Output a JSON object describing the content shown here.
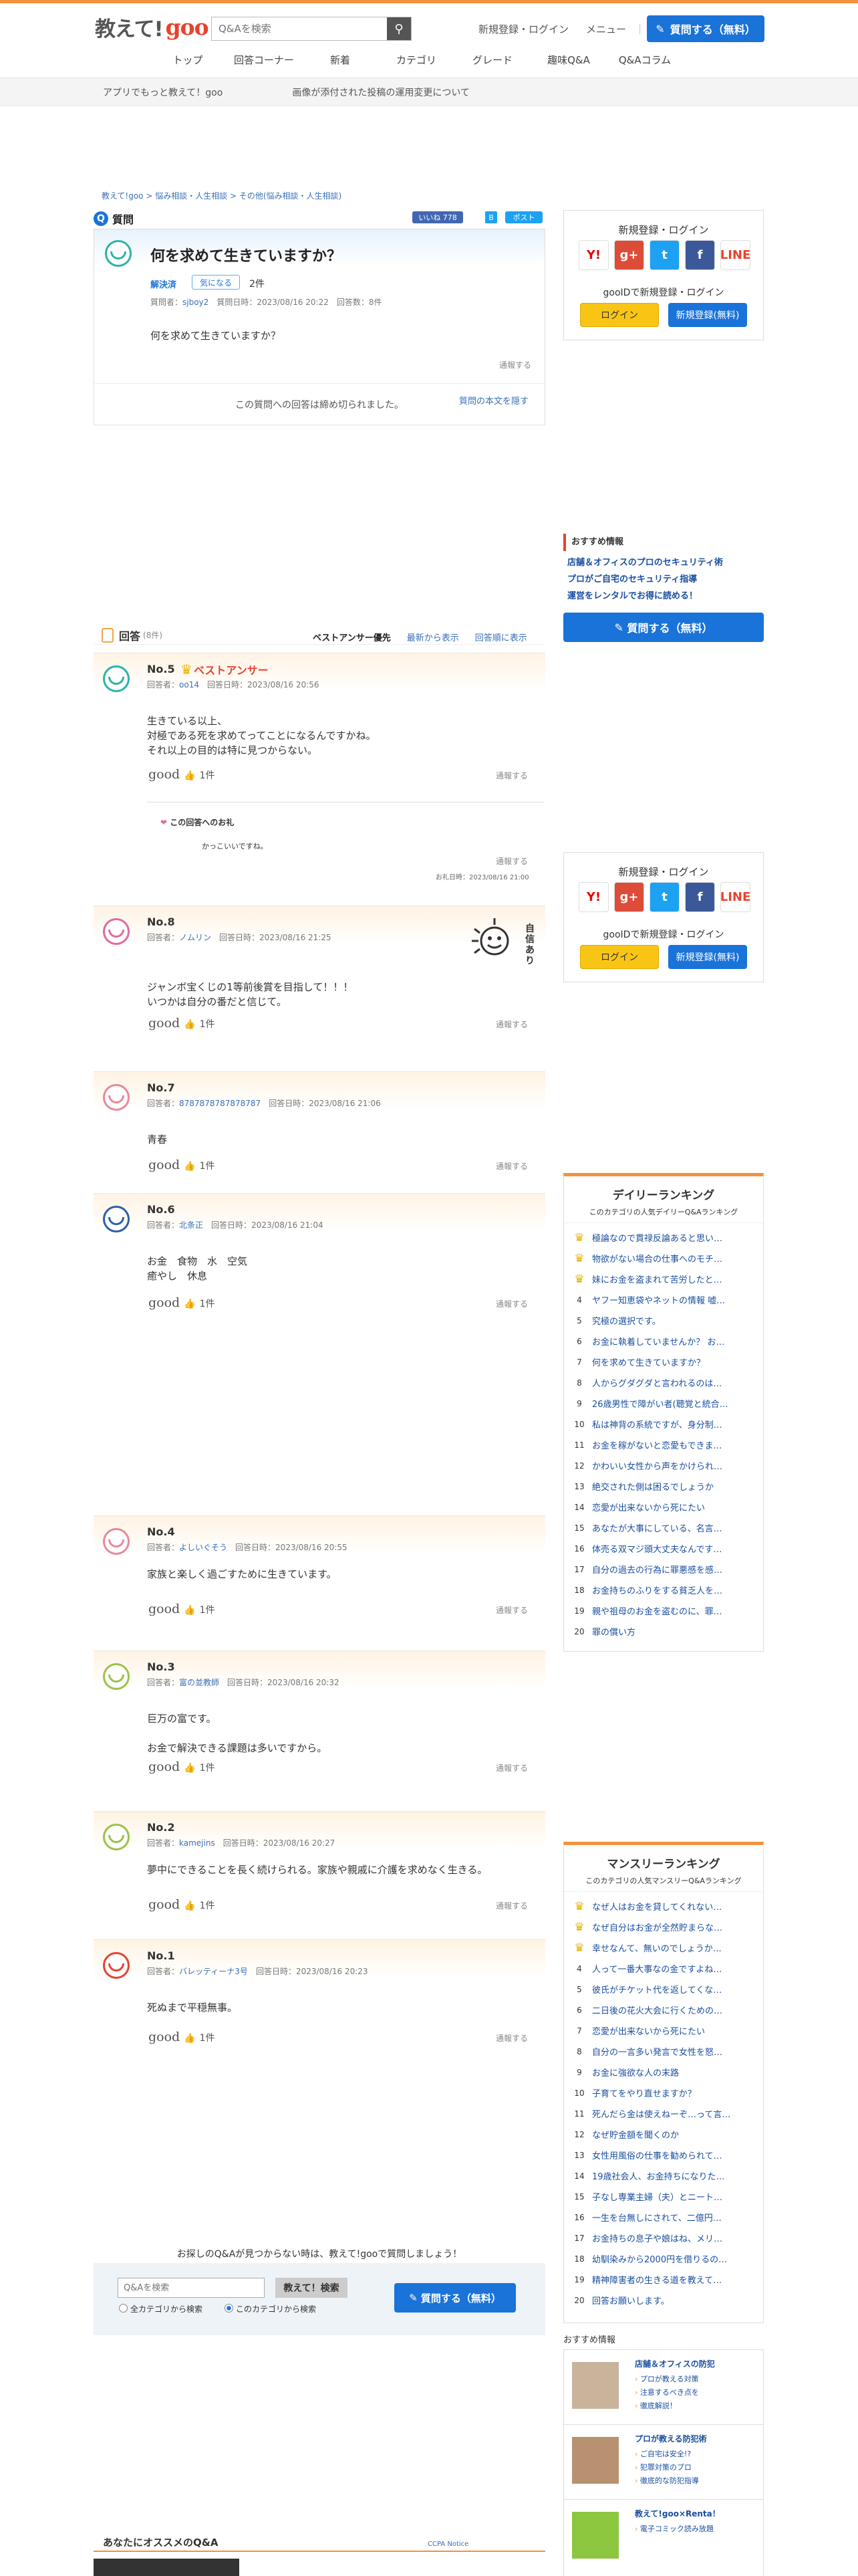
{
  "header": {
    "logo_a": "教えて!",
    "logo_b": "goo",
    "search_placeholder": "Q&Aを検索",
    "login": "新規登録・ログイン",
    "menu": "メニュー",
    "ask": "質問する（無料）"
  },
  "nav": [
    "トップ",
    "回答コーナー",
    "新着",
    "カテゴリ",
    "グレード",
    "趣味Q&A",
    "Q&Aコラム"
  ],
  "infobar": [
    "アプリでもっと教えて！goo",
    "画像が添付された投稿の運用変更について"
  ],
  "breadcrumb": "教えて!goo >  悩み相談・人生相談 >  その他(悩み相談・人生相談)",
  "question": {
    "section": "質問",
    "fb": "いいね 778",
    "tw": "ポスト",
    "title": "何を求めて生きていますか？",
    "solved": "解決済",
    "kini": "気になる",
    "count": "2件",
    "meta_prefix": "質問者：",
    "user": "sjboy2",
    "meta_rest": "質問日時：2023/08/16 20:22　回答数：8件",
    "body": "何を求めて生きていますか？",
    "report": "通報する",
    "closed": "この質問への回答は締め切られました。",
    "link": "質問の本文を隠す"
  },
  "login_box": {
    "title": "新規登録・ログイン",
    "goo_id": "gooIDで新規登録・ログイン",
    "login": "ログイン",
    "register": "新規登録(無料)"
  },
  "sns": [
    "Y!",
    "g+",
    "t",
    "f",
    "LINE"
  ],
  "recommend": {
    "title": "おすすめ情報",
    "items": [
      "店舗＆オフィスのプロのセキュリティ術",
      "プロがご自宅のセキュリティ指導",
      "運営をレンタルでお得に読める！"
    ],
    "ask": "質問する（無料）"
  },
  "answers_head": {
    "title": "回答",
    "count": "(8件)",
    "sorts": [
      "ベストアンサー優先",
      "最新から表示",
      "回答順に表示"
    ]
  },
  "best_label": "ベストアンサー",
  "answers": [
    {
      "no": "No.5",
      "user": "oo14",
      "date": "回答日時：2023/08/16 20:56",
      "body": "生きている以上、\n対極である死を求めてってことになるんですかね。\nそれ以上の目的は特に見つからない。",
      "count": "1件"
    },
    {
      "no": "No.8",
      "user": "ノムリン",
      "date": "回答日時：2023/08/16 21:25",
      "body": "ジャンボ宝くじの1等前後賞を目指して！！！\nいつかは自分の番だと信じて。",
      "count": "1件"
    },
    {
      "no": "No.7",
      "user": "8787878787878787",
      "date": "回答日時：2023/08/16 21:06",
      "body": "青春",
      "count": "1件"
    },
    {
      "no": "No.6",
      "user": "北条正",
      "date": "回答日時：2023/08/16 21:04",
      "body": "お金　食物　水　空気\n癒やし　休息",
      "count": "1件"
    },
    {
      "no": "No.4",
      "user": "よしいぐそう",
      "date": "回答日時：2023/08/16 20:55",
      "body": "家族と楽しく過ごすために生きています。",
      "count": "1件"
    },
    {
      "no": "No.3",
      "user": "富の並教師",
      "date": "回答日時：2023/08/16 20:32",
      "body": "巨万の富です。\n\nお金で解決できる課題は多いですから。",
      "count": "1件"
    },
    {
      "no": "No.2",
      "user": "kamejins",
      "date": "回答日時：2023/08/16 20:27",
      "body": "夢中にできることを長く続けられる。家族や親戚に介護を求めなく生きる。",
      "count": "1件"
    },
    {
      "no": "No.1",
      "user": "バレッティーナ3号",
      "date": "回答日時：2023/08/16 20:23",
      "body": "死ぬまで平穏無事。",
      "count": "1件"
    }
  ],
  "answer_meta_prefix": "回答者：",
  "good": "good",
  "report": "通報する",
  "thanks": {
    "title": "この回答へのお礼",
    "body": "かっこいいですね。",
    "date": "お礼日時：2023/08/16 21:00"
  },
  "stamp": "自信あり",
  "daily_ranking": {
    "title": "デイリーランキング",
    "sub": "このカテゴリの人気デイリーQ&Aランキング",
    "items": [
      "極論なので貫禄反論あると思い…",
      "物欲がない場合の仕事へのモチ…",
      "妹にお金を盗まれて苦労したと…",
      "ヤフー知恵袋やネットの情報 嘘…",
      "究極の選択です。",
      "お金に執着していませんか？ お…",
      "何を求めて生きていますか？",
      "人からグダグダと言われるのは…",
      "26歳男性で障がい者(聴覚と統合…",
      "私は神背の系統ですが、身分制…",
      "お金を稼がないと恋愛もできま…",
      "かわいい女性から声をかけられ…",
      "絶交された側は困るでしょうか",
      "恋愛が出来ないから死にたい",
      "あなたが大事にしている、名言…",
      "体売る双マジ頭大丈夫なんです…",
      "自分の過去の行為に罪悪感を感…",
      "お金持ちのふりをする貧乏人を…",
      "親や祖母のお金を盗むのに、罪…",
      "罪の償い方"
    ]
  },
  "monthly_ranking": {
    "title": "マンスリーランキング",
    "sub": "このカテゴリの人気マンスリーQ&Aランキング",
    "items": [
      "なぜ人はお金を貸してくれない…",
      "なぜ自分はお金が全然貯まらな…",
      "幸せなんて、無いのでしょうか…",
      "人って一番大事なの金ですよね…",
      "彼氏がチケット代を返してくな…",
      "二日後の花火大会に行くための…",
      "恋愛が出来ないから死にたい",
      "自分の一言多い発言で女性を怒…",
      "お金に強欲な人の末路",
      "子育てをやり直せますか？",
      "死んだら金は使えねーぞ…って言…",
      "なぜ貯金額を聞くのか",
      "女性用風俗の仕事を勧められて…",
      "19歳社会人、お金持ちになりた…",
      "子なし専業主婦（夫）とニート…",
      "一生を台無しにされて、二億円…",
      "お金持ちの息子や娘はね、メリ…",
      "幼馴染みから2000円を借りるの…",
      "精神障害者の生きる道を教えて…",
      "回答お願いします。"
    ]
  },
  "bottom": {
    "msg": "お探しのQ&Aが見つからない時は、教えて!gooで質問しましょう！",
    "placeholder": "Q&Aを検索",
    "search": "教えて！検索",
    "r1": "全カテゴリから検索",
    "r2": "このカテゴリから検索",
    "ask": "質問する（無料）"
  },
  "recommend2": {
    "title": "おすすめ情報",
    "cards": [
      {
        "title": "店舗＆オフィスの防犯",
        "items": [
          "プロが教える対策",
          "注意するべき点を",
          "徹底解説！"
        ]
      },
      {
        "title": "プロが教える防犯術",
        "items": [
          "ご自宅は安全!?",
          "犯罪対策のプロ",
          "徹底的な防犯指導"
        ]
      },
      {
        "title": "教えて!goo×Renta！",
        "items": [
          "電子コミック読み放題"
        ]
      }
    ]
  },
  "osusume": "あなたにオススメのQ&A",
  "ccpa": "CCPA Notice"
}
